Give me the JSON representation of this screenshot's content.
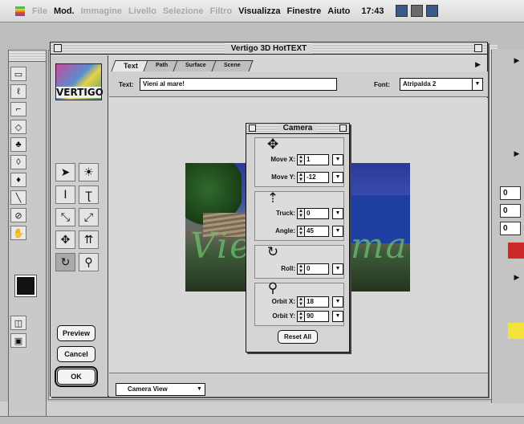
{
  "menubar": {
    "items": [
      {
        "label": "File",
        "dim": true
      },
      {
        "label": "Mod.",
        "dim": false
      },
      {
        "label": "Immagine",
        "dim": true
      },
      {
        "label": "Livello",
        "dim": true
      },
      {
        "label": "Selezione",
        "dim": true
      },
      {
        "label": "Filtro",
        "dim": true
      },
      {
        "label": "Visualizza",
        "dim": false
      },
      {
        "label": "Finestre",
        "dim": false
      },
      {
        "label": "Aiuto",
        "dim": false
      }
    ],
    "clock": "17:43"
  },
  "vertigo": {
    "title": "Vertigo 3D HotTEXT",
    "logo_text": "VERTIGO",
    "tabs": [
      {
        "label": "Text",
        "active": true
      },
      {
        "label": "Path",
        "active": false
      },
      {
        "label": "Surface",
        "active": false
      },
      {
        "label": "Scene",
        "active": false
      }
    ],
    "text_label": "Text:",
    "text_value": "Vieni al mare!",
    "font_label": "Font:",
    "font_value": "Atripalda 2",
    "preview_label": "Preview",
    "cancel_label": "Cancel",
    "ok_label": "OK",
    "view_select": "Camera View",
    "image_text": "Vieni al mare!"
  },
  "camera": {
    "title": "Camera",
    "move_x_label": "Move X:",
    "move_x_value": "1",
    "move_y_label": "Move Y:",
    "move_y_value": "-12",
    "truck_label": "Truck:",
    "truck_value": "0",
    "angle_label": "Angle:",
    "angle_value": "45",
    "roll_label": "Roll:",
    "roll_value": "0",
    "orbit_x_label": "Orbit X:",
    "orbit_x_value": "18",
    "orbit_y_label": "Orbit Y:",
    "orbit_y_value": "90",
    "reset_label": "Reset All"
  },
  "right_panel": {
    "fields": [
      "0",
      "0",
      "0"
    ]
  },
  "colors": {
    "dialog_bg": "#d6d6d6",
    "image_text": "#6cc06a"
  }
}
